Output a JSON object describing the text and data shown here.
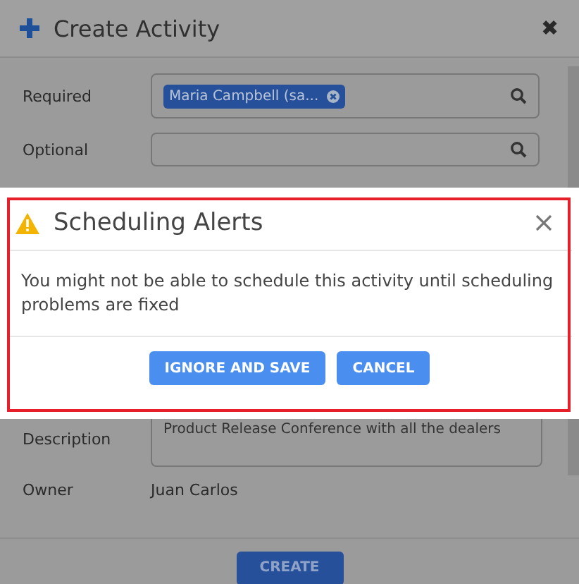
{
  "window": {
    "title": "Create Activity",
    "close_icon": "✖"
  },
  "fields": [
    {
      "label": "Required",
      "kind": "lookup",
      "tokens": [
        "Maria Campbell (sa..."
      ]
    },
    {
      "label": "Optional",
      "kind": "lookup"
    },
    {
      "label": "Description",
      "kind": "textarea",
      "value": "Product Release Conference with all the dealers"
    },
    {
      "label": "Owner",
      "kind": "text",
      "value": "Juan Carlos"
    }
  ],
  "create_button": "CREATE",
  "dialog": {
    "title": "Scheduling Alerts",
    "message": "You might not be able to schedule this activity until scheduling problems are fixed",
    "buttons": [
      "IGNORE AND SAVE",
      "CANCEL"
    ]
  }
}
